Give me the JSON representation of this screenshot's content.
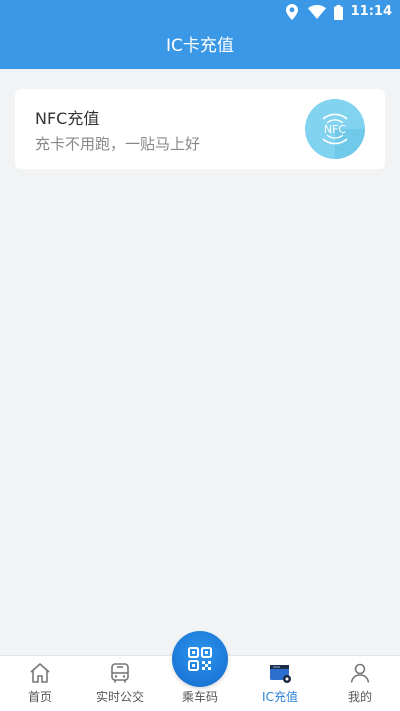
{
  "status": {
    "time": "11:14"
  },
  "header": {
    "title": "IC卡充值"
  },
  "nfc_card": {
    "title": "NFC充值",
    "subtitle": "充卡不用跑，一贴马上好",
    "badge_text": "NFC",
    "badge_color": "#80d4f0"
  },
  "tabs": [
    {
      "label": "首页",
      "icon": "home-icon"
    },
    {
      "label": "实时公交",
      "icon": "bus-icon"
    },
    {
      "label": "乘车码",
      "icon": "qr-code-icon"
    },
    {
      "label": "IC充值",
      "icon": "ic-card-icon",
      "active": true
    },
    {
      "label": "我的",
      "icon": "user-icon"
    }
  ],
  "colors": {
    "primary": "#3a98e6",
    "active_tab": "#2a83d8",
    "background": "#f2f3f5"
  }
}
